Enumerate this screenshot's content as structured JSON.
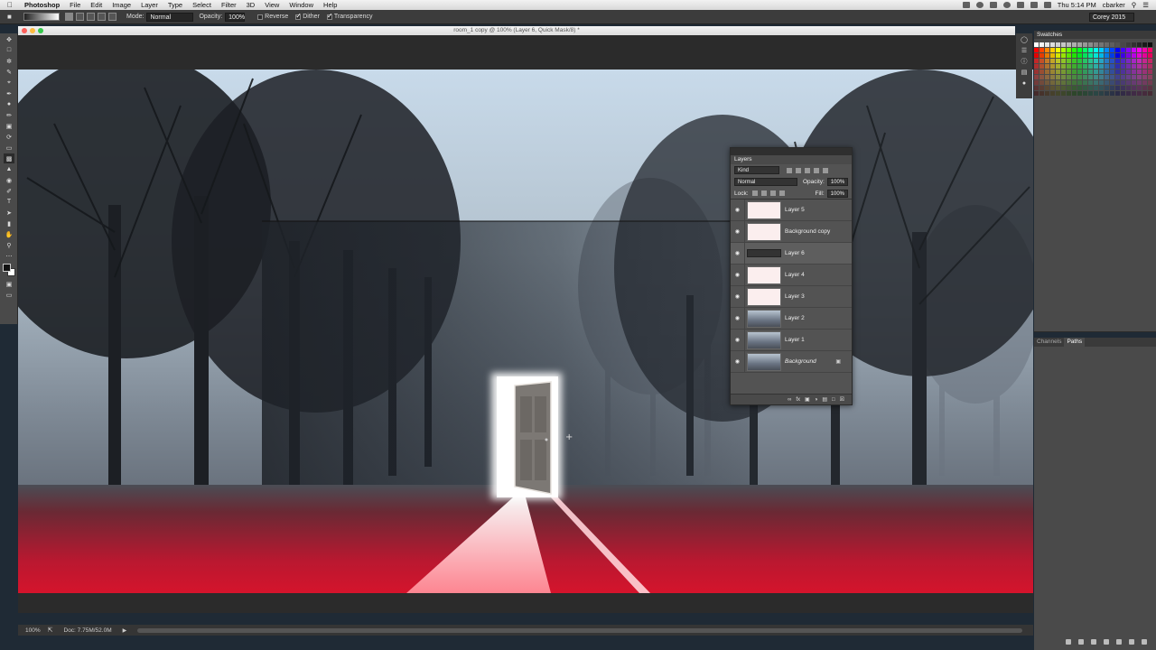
{
  "menubar": {
    "app": "Photoshop",
    "items": [
      "File",
      "Edit",
      "Image",
      "Layer",
      "Type",
      "Select",
      "Filter",
      "3D",
      "View",
      "Window",
      "Help"
    ],
    "clock": "Thu 5:14 PM",
    "user": "cbarker"
  },
  "options": {
    "mode_label": "Mode:",
    "mode_value": "Normal",
    "opacity_label": "Opacity:",
    "opacity_value": "100%",
    "reverse": "Reverse",
    "dither": "Dither",
    "transparency": "Transparency",
    "workspace": "Corey 2015"
  },
  "document": {
    "title": "room_1 copy @ 100% (Layer 6, Quick Mask/8) *",
    "zoom": "100%",
    "doc_size": "Doc: 7.75M/52.0M"
  },
  "swatches": {
    "title": "Swatches"
  },
  "channels_paths": {
    "tabs": [
      "Channels",
      "Paths"
    ]
  },
  "layers_panel": {
    "title": "Layers",
    "filter": "Kind",
    "blend_mode": "Normal",
    "opacity_label": "Opacity:",
    "opacity_value": "100%",
    "lock_label": "Lock:",
    "fill_label": "Fill:",
    "fill_value": "100%",
    "layers": [
      {
        "name": "Layer 5"
      },
      {
        "name": "Background copy"
      },
      {
        "name": "Layer 6"
      },
      {
        "name": "Layer 4"
      },
      {
        "name": "Layer 3"
      },
      {
        "name": "Layer 2"
      },
      {
        "name": "Layer 1"
      },
      {
        "name": "Background"
      }
    ]
  },
  "colors": {
    "accent_red": "#d5142c",
    "door_glow": "#ffffff"
  }
}
